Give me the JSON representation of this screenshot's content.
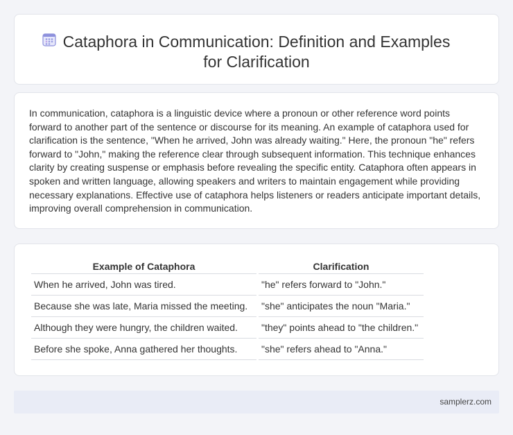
{
  "header": {
    "title_line1": "Cataphora in Communication: Definition and Examples",
    "title_line2": "for Clarification",
    "icon": "calendar-grid-icon",
    "icon_color": "#7b7fd6"
  },
  "description": {
    "text": "In communication, cataphora is a linguistic device where a pronoun or other reference word points forward to another part of the sentence or discourse for its meaning. An example of cataphora used for clarification is the sentence, \"When he arrived, John was already waiting.\" Here, the pronoun \"he\" refers forward to \"John,\" making the reference clear through subsequent information. This technique enhances clarity by creating suspense or emphasis before revealing the specific entity. Cataphora often appears in spoken and written language, allowing speakers and writers to maintain engagement while providing necessary explanations. Effective use of cataphora helps listeners or readers anticipate important details, improving overall comprehension in communication."
  },
  "table": {
    "headers": [
      "Example of Cataphora",
      "Clarification"
    ],
    "rows": [
      [
        "When he arrived, John was tired.",
        "\"he\" refers forward to \"John.\""
      ],
      [
        "Because she was late, Maria missed the meeting.",
        "\"she\" anticipates the noun \"Maria.\""
      ],
      [
        "Although they were hungry, the children waited.",
        "\"they\" points ahead to \"the children.\""
      ],
      [
        "Before she spoke, Anna gathered her thoughts.",
        "\"she\" refers ahead to \"Anna.\""
      ]
    ]
  },
  "footer": {
    "site": "samplerz.com"
  }
}
